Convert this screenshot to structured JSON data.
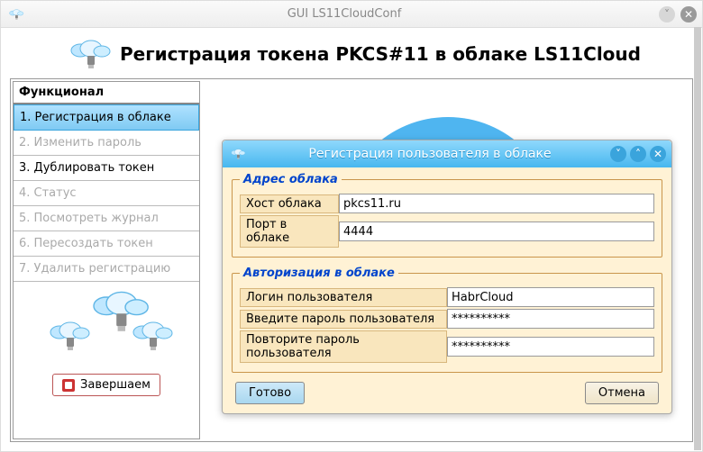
{
  "window": {
    "title": "GUI LS11CloudConf"
  },
  "banner": {
    "heading": "Регистрация токена PKCS#11 в облаке LS11Cloud"
  },
  "sidebar": {
    "title": "Функционал",
    "items": [
      {
        "label": "1. Регистрация в облаке",
        "enabled": true,
        "selected": true
      },
      {
        "label": "2. Изменить пароль",
        "enabled": false,
        "selected": false
      },
      {
        "label": "3. Дублировать токен",
        "enabled": true,
        "selected": false
      },
      {
        "label": "4. Статус",
        "enabled": false,
        "selected": false
      },
      {
        "label": "5. Посмотреть журнал",
        "enabled": false,
        "selected": false
      },
      {
        "label": "6. Пересоздать токен",
        "enabled": false,
        "selected": false
      },
      {
        "label": "7. Удалить регистрацию",
        "enabled": false,
        "selected": false
      }
    ],
    "finish_label": "Завершаем"
  },
  "dialog": {
    "title": "Регистрация пользователя в облаке",
    "group_address": {
      "legend": "Адрес облака",
      "host_label": "Хост облака",
      "host_value": "pkcs11.ru",
      "port_label": "Порт в облаке",
      "port_value": "4444"
    },
    "group_auth": {
      "legend": "Авторизация в облаке",
      "login_label": "Логин пользователя",
      "login_value": "HabrCloud",
      "pass_label": "Введите пароль пользователя",
      "pass_value": "**********",
      "pass2_label": "Повторите пароль пользователя",
      "pass2_value": "**********"
    },
    "ok_label": "Готово",
    "cancel_label": "Отмена"
  }
}
